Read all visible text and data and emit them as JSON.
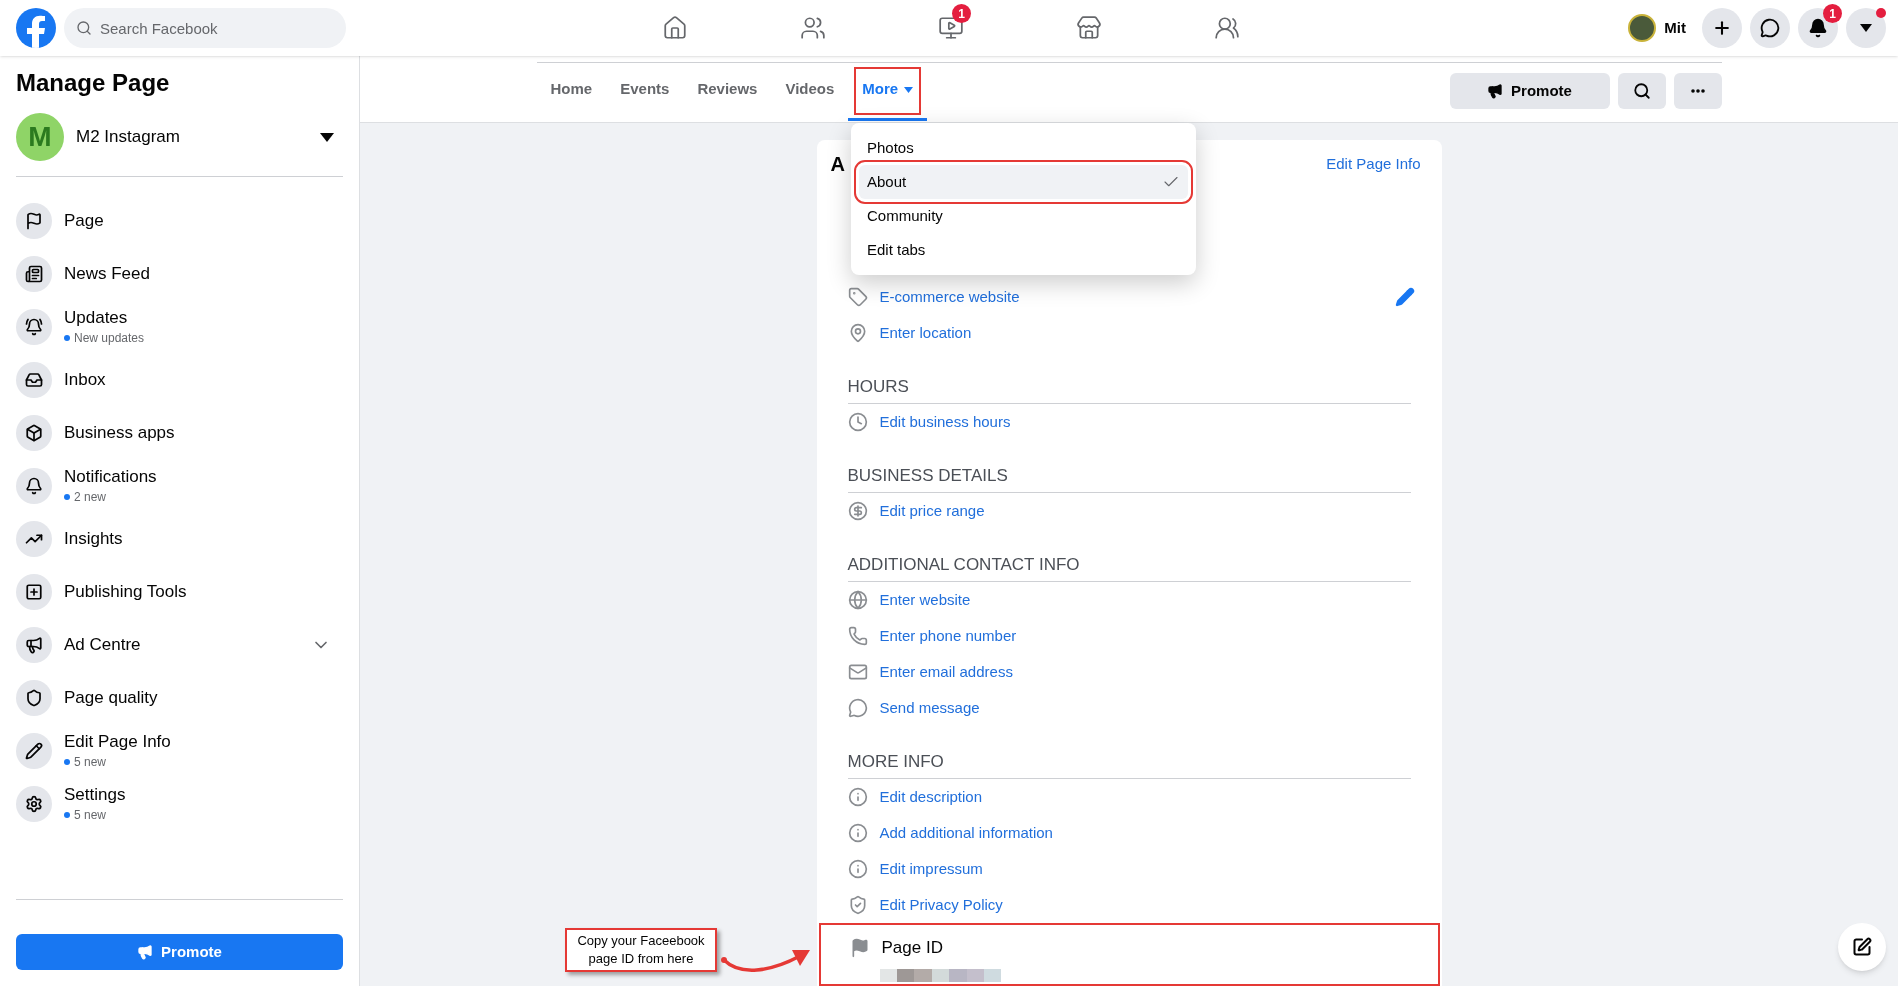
{
  "topbar": {
    "search": {
      "placeholder": "Search Facebook"
    },
    "video_badge": "1",
    "user": {
      "name": "Mit"
    },
    "notifications_badge": "1",
    "account_dot": true
  },
  "sidebar": {
    "title": "Manage Page",
    "page": {
      "initial": "M",
      "name": "M2 Instagram"
    },
    "items": [
      {
        "label": "Page",
        "kind": "link"
      },
      {
        "label": "News Feed",
        "kind": "link"
      },
      {
        "label": "Updates",
        "sub": "New updates",
        "kind": "link"
      },
      {
        "label": "Inbox",
        "kind": "link"
      },
      {
        "label": "Business apps",
        "kind": "link"
      },
      {
        "label": "Notifications",
        "sub": "2 new",
        "kind": "link"
      },
      {
        "label": "Insights",
        "kind": "link"
      },
      {
        "label": "Publishing Tools",
        "kind": "link"
      },
      {
        "label": "Ad Centre",
        "kind": "expandable"
      },
      {
        "label": "Page quality",
        "kind": "link"
      },
      {
        "label": "Edit Page Info",
        "sub": "5 new",
        "kind": "link"
      },
      {
        "label": "Settings",
        "sub": "5 new",
        "kind": "link"
      }
    ],
    "promote": "Promote"
  },
  "tabs": [
    {
      "label": "Home",
      "selected": false,
      "highlighted": false
    },
    {
      "label": "Events",
      "selected": false,
      "highlighted": false
    },
    {
      "label": "Reviews",
      "selected": false,
      "highlighted": false
    },
    {
      "label": "Videos",
      "selected": false,
      "highlighted": false
    },
    {
      "label": "More",
      "selected": true,
      "highlighted": true
    }
  ],
  "tab_actions": {
    "promote": "Promote"
  },
  "dropdown": {
    "items": [
      {
        "label": "Photos",
        "selected": false,
        "highlighted": false
      },
      {
        "label": "About",
        "selected": true,
        "highlighted": true
      },
      {
        "label": "Community",
        "selected": false,
        "highlighted": false
      },
      {
        "label": "Edit tabs",
        "selected": false,
        "highlighted": false
      }
    ]
  },
  "card": {
    "title": "A",
    "edit_link": "Edit Page Info",
    "sections": [
      {
        "rows": [
          "E-commerce website",
          "Enter location"
        ]
      },
      {
        "heading": "HOURS",
        "rows": [
          "Edit business hours"
        ]
      },
      {
        "heading": "BUSINESS DETAILS",
        "rows": [
          "Edit price range"
        ]
      },
      {
        "heading": "ADDITIONAL CONTACT INFO",
        "rows": [
          "Enter website",
          "Enter phone number",
          "Enter email address",
          "Send message"
        ]
      },
      {
        "heading": "MORE INFO",
        "rows": [
          "Edit description",
          "Add additional information",
          "Edit impressum",
          "Edit Privacy Policy"
        ]
      }
    ],
    "page_id": {
      "label": "Page ID",
      "highlighted": true
    }
  },
  "callout": {
    "text": "Copy your Faceebook page ID from here"
  }
}
